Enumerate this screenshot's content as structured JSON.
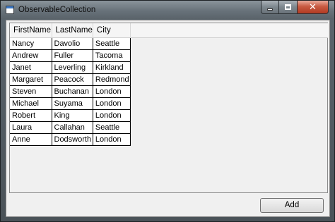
{
  "window": {
    "title": "ObservableCollection",
    "minimize_icon": "minimize-icon",
    "maximize_icon": "maximize-icon",
    "close_icon": "close-icon",
    "close_glyph": "✕"
  },
  "grid": {
    "columns": [
      "FirstName",
      "LastName",
      "City"
    ],
    "rows": [
      [
        "Nancy",
        "Davolio",
        "Seattle"
      ],
      [
        "Andrew",
        "Fuller",
        "Tacoma"
      ],
      [
        "Janet",
        "Leverling",
        "Kirkland"
      ],
      [
        "Margaret",
        "Peacock",
        "Redmond"
      ],
      [
        "Steven",
        "Buchanan",
        "London"
      ],
      [
        "Michael",
        "Suyama",
        "London"
      ],
      [
        "Robert",
        "King",
        "London"
      ],
      [
        "Laura",
        "Callahan",
        "Seattle"
      ],
      [
        "Anne",
        "Dodsworth",
        "London"
      ]
    ]
  },
  "actions": {
    "add_label": "Add"
  }
}
